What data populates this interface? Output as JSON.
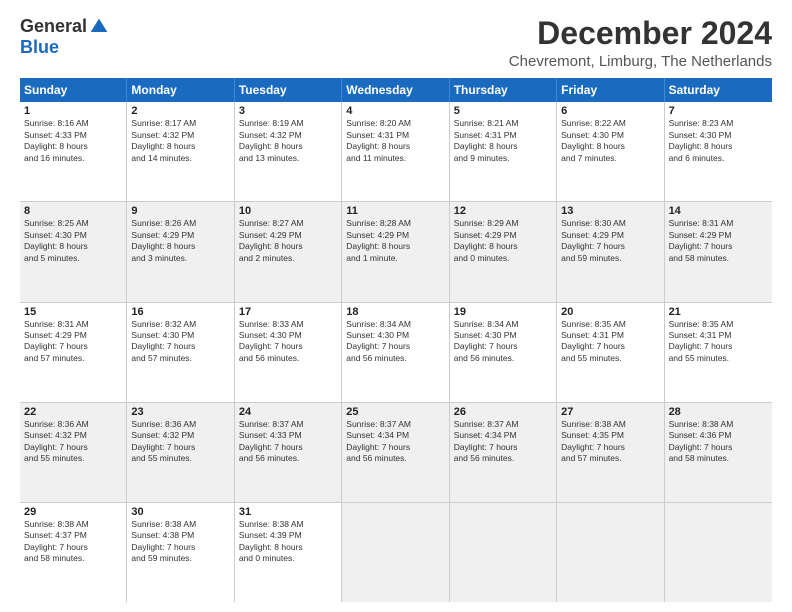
{
  "logo": {
    "general": "General",
    "blue": "Blue"
  },
  "header": {
    "title": "December 2024",
    "subtitle": "Chevremont, Limburg, The Netherlands"
  },
  "days": [
    "Sunday",
    "Monday",
    "Tuesday",
    "Wednesday",
    "Thursday",
    "Friday",
    "Saturday"
  ],
  "weeks": [
    [
      {
        "day": "1",
        "content": "Sunrise: 8:16 AM\nSunset: 4:33 PM\nDaylight: 8 hours\nand 16 minutes.",
        "shaded": false
      },
      {
        "day": "2",
        "content": "Sunrise: 8:17 AM\nSunset: 4:32 PM\nDaylight: 8 hours\nand 14 minutes.",
        "shaded": false
      },
      {
        "day": "3",
        "content": "Sunrise: 8:19 AM\nSunset: 4:32 PM\nDaylight: 8 hours\nand 13 minutes.",
        "shaded": false
      },
      {
        "day": "4",
        "content": "Sunrise: 8:20 AM\nSunset: 4:31 PM\nDaylight: 8 hours\nand 11 minutes.",
        "shaded": false
      },
      {
        "day": "5",
        "content": "Sunrise: 8:21 AM\nSunset: 4:31 PM\nDaylight: 8 hours\nand 9 minutes.",
        "shaded": false
      },
      {
        "day": "6",
        "content": "Sunrise: 8:22 AM\nSunset: 4:30 PM\nDaylight: 8 hours\nand 7 minutes.",
        "shaded": false
      },
      {
        "day": "7",
        "content": "Sunrise: 8:23 AM\nSunset: 4:30 PM\nDaylight: 8 hours\nand 6 minutes.",
        "shaded": false
      }
    ],
    [
      {
        "day": "8",
        "content": "Sunrise: 8:25 AM\nSunset: 4:30 PM\nDaylight: 8 hours\nand 5 minutes.",
        "shaded": true
      },
      {
        "day": "9",
        "content": "Sunrise: 8:26 AM\nSunset: 4:29 PM\nDaylight: 8 hours\nand 3 minutes.",
        "shaded": true
      },
      {
        "day": "10",
        "content": "Sunrise: 8:27 AM\nSunset: 4:29 PM\nDaylight: 8 hours\nand 2 minutes.",
        "shaded": true
      },
      {
        "day": "11",
        "content": "Sunrise: 8:28 AM\nSunset: 4:29 PM\nDaylight: 8 hours\nand 1 minute.",
        "shaded": true
      },
      {
        "day": "12",
        "content": "Sunrise: 8:29 AM\nSunset: 4:29 PM\nDaylight: 8 hours\nand 0 minutes.",
        "shaded": true
      },
      {
        "day": "13",
        "content": "Sunrise: 8:30 AM\nSunset: 4:29 PM\nDaylight: 7 hours\nand 59 minutes.",
        "shaded": true
      },
      {
        "day": "14",
        "content": "Sunrise: 8:31 AM\nSunset: 4:29 PM\nDaylight: 7 hours\nand 58 minutes.",
        "shaded": true
      }
    ],
    [
      {
        "day": "15",
        "content": "Sunrise: 8:31 AM\nSunset: 4:29 PM\nDaylight: 7 hours\nand 57 minutes.",
        "shaded": false
      },
      {
        "day": "16",
        "content": "Sunrise: 8:32 AM\nSunset: 4:30 PM\nDaylight: 7 hours\nand 57 minutes.",
        "shaded": false
      },
      {
        "day": "17",
        "content": "Sunrise: 8:33 AM\nSunset: 4:30 PM\nDaylight: 7 hours\nand 56 minutes.",
        "shaded": false
      },
      {
        "day": "18",
        "content": "Sunrise: 8:34 AM\nSunset: 4:30 PM\nDaylight: 7 hours\nand 56 minutes.",
        "shaded": false
      },
      {
        "day": "19",
        "content": "Sunrise: 8:34 AM\nSunset: 4:30 PM\nDaylight: 7 hours\nand 56 minutes.",
        "shaded": false
      },
      {
        "day": "20",
        "content": "Sunrise: 8:35 AM\nSunset: 4:31 PM\nDaylight: 7 hours\nand 55 minutes.",
        "shaded": false
      },
      {
        "day": "21",
        "content": "Sunrise: 8:35 AM\nSunset: 4:31 PM\nDaylight: 7 hours\nand 55 minutes.",
        "shaded": false
      }
    ],
    [
      {
        "day": "22",
        "content": "Sunrise: 8:36 AM\nSunset: 4:32 PM\nDaylight: 7 hours\nand 55 minutes.",
        "shaded": true
      },
      {
        "day": "23",
        "content": "Sunrise: 8:36 AM\nSunset: 4:32 PM\nDaylight: 7 hours\nand 55 minutes.",
        "shaded": true
      },
      {
        "day": "24",
        "content": "Sunrise: 8:37 AM\nSunset: 4:33 PM\nDaylight: 7 hours\nand 56 minutes.",
        "shaded": true
      },
      {
        "day": "25",
        "content": "Sunrise: 8:37 AM\nSunset: 4:34 PM\nDaylight: 7 hours\nand 56 minutes.",
        "shaded": true
      },
      {
        "day": "26",
        "content": "Sunrise: 8:37 AM\nSunset: 4:34 PM\nDaylight: 7 hours\nand 56 minutes.",
        "shaded": true
      },
      {
        "day": "27",
        "content": "Sunrise: 8:38 AM\nSunset: 4:35 PM\nDaylight: 7 hours\nand 57 minutes.",
        "shaded": true
      },
      {
        "day": "28",
        "content": "Sunrise: 8:38 AM\nSunset: 4:36 PM\nDaylight: 7 hours\nand 58 minutes.",
        "shaded": true
      }
    ],
    [
      {
        "day": "29",
        "content": "Sunrise: 8:38 AM\nSunset: 4:37 PM\nDaylight: 7 hours\nand 58 minutes.",
        "shaded": false
      },
      {
        "day": "30",
        "content": "Sunrise: 8:38 AM\nSunset: 4:38 PM\nDaylight: 7 hours\nand 59 minutes.",
        "shaded": false
      },
      {
        "day": "31",
        "content": "Sunrise: 8:38 AM\nSunset: 4:39 PM\nDaylight: 8 hours\nand 0 minutes.",
        "shaded": false
      },
      {
        "day": "",
        "content": "",
        "shaded": true,
        "empty": true
      },
      {
        "day": "",
        "content": "",
        "shaded": true,
        "empty": true
      },
      {
        "day": "",
        "content": "",
        "shaded": true,
        "empty": true
      },
      {
        "day": "",
        "content": "",
        "shaded": true,
        "empty": true
      }
    ]
  ]
}
